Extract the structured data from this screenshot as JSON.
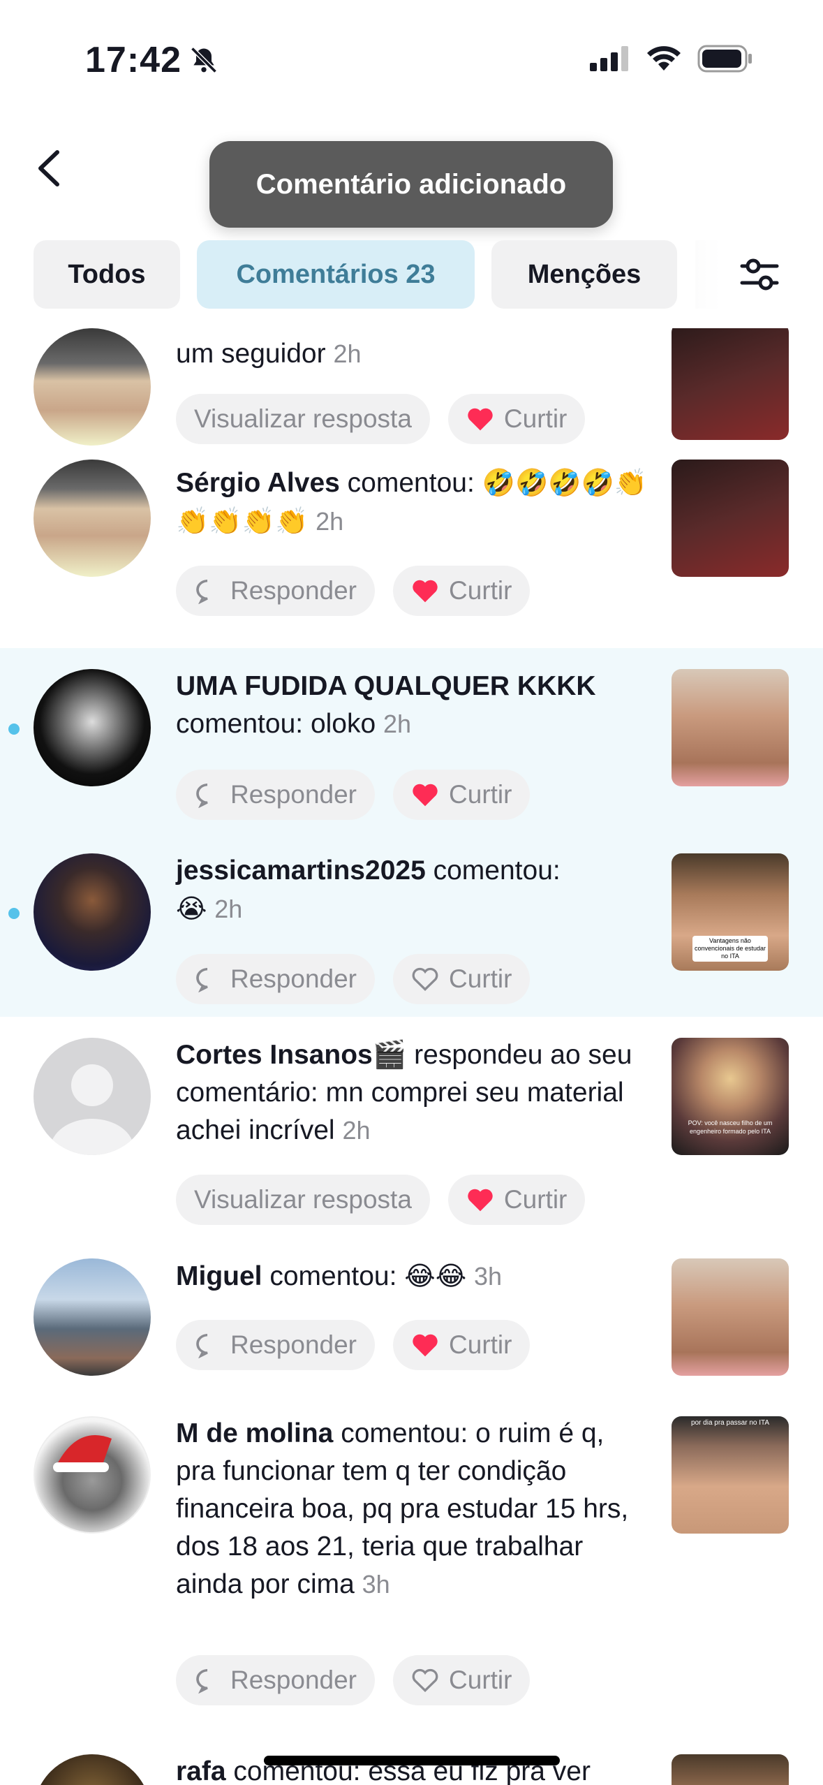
{
  "status_bar": {
    "time": "17:42"
  },
  "toast": {
    "text": "Comentário adicionado"
  },
  "tabs": [
    {
      "label": "Todos"
    },
    {
      "label": "Comentários 23"
    },
    {
      "label": "Menções"
    }
  ],
  "actions": {
    "reply": "Responder",
    "like": "Curtir",
    "view_reply": "Visualizar resposta"
  },
  "notifications": [
    {
      "user": "",
      "text": "um seguidor",
      "time": "2h",
      "action": "view_reply",
      "liked": true
    },
    {
      "user": "Sérgio Alves",
      "text": "comentou:",
      "emoji": "🤣🤣🤣🤣👏👏👏👏👏",
      "time": "2h",
      "action": "reply",
      "liked": true
    },
    {
      "user": "UMA FUDIDA QUALQUER KKKK",
      "text": "comentou: oloko",
      "time": "2h",
      "action": "reply",
      "liked": true,
      "unread": true
    },
    {
      "user": "jessicamartins2025",
      "text": "comentou:",
      "emoji": "😭",
      "time": "2h",
      "action": "reply",
      "liked": false,
      "unread": true
    },
    {
      "user": "Cortes Insanos🎬",
      "text": "respondeu ao seu comentário: mn comprei seu material achei incrível",
      "time": "2h",
      "action": "view_reply",
      "liked": true
    },
    {
      "user": "Miguel",
      "text": "comentou:",
      "emoji": "😂😂",
      "time": "3h",
      "action": "reply",
      "liked": true
    },
    {
      "user": "M de molina",
      "text": "comentou: o ruim é q, pra funcionar tem q ter condição financeira boa, pq pra estudar 15 hrs, dos 18 aos 21, teria que trabalhar ainda por cima",
      "time": "3h",
      "action": "reply",
      "liked": false
    },
    {
      "user": "rafa",
      "text": "comentou: essa eu fiz pra ver"
    }
  ],
  "thumb_captions": {
    "jessica": "Vantagens não convencionais de estudar no ITA",
    "cortes": "POV: você nasceu filho de um engenheiro formado pelo ITA",
    "molina": "por dia pra passar no ITA"
  },
  "colors": {
    "accent": "#3f7d98",
    "like_red": "#fe2c55",
    "unread_bg": "#f0f9fc",
    "dot": "#55c2ea"
  }
}
